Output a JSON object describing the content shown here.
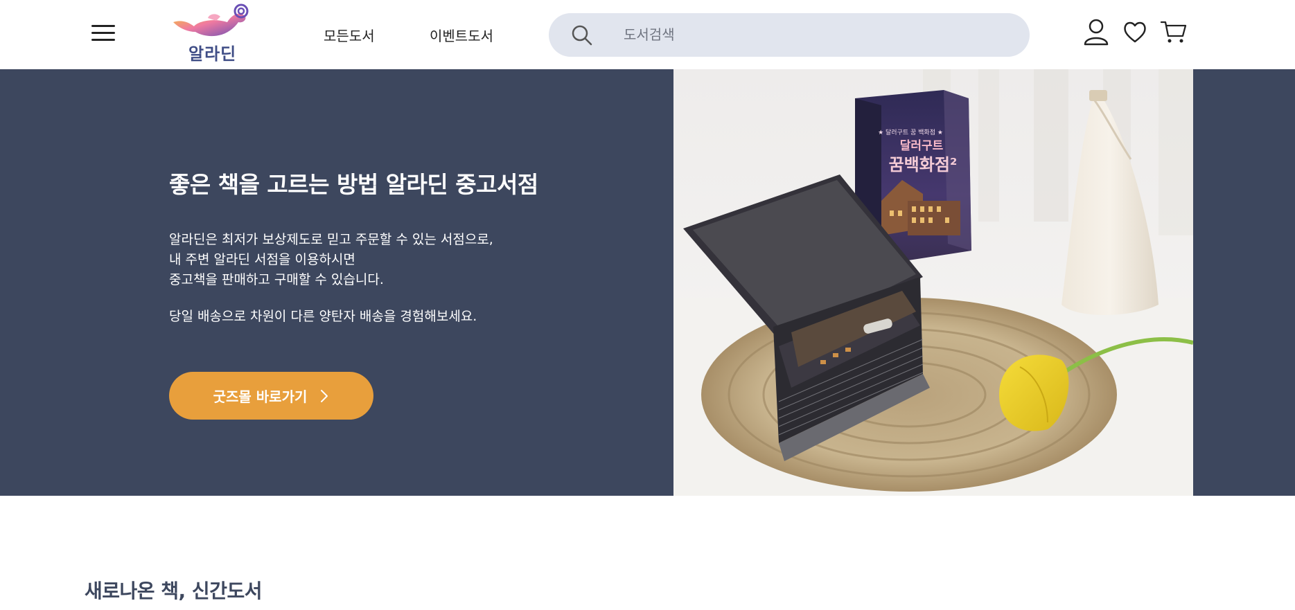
{
  "header": {
    "logo_text": "알라딘",
    "nav": {
      "all_books": "모든도서",
      "event_books": "이벤트도서"
    },
    "search": {
      "placeholder": "도서검색",
      "value": ""
    },
    "icons": [
      "menu-icon",
      "user-icon",
      "heart-icon",
      "cart-icon",
      "search-icon"
    ]
  },
  "hero": {
    "title": "좋은 책을 고르는 방법 알라딘 중고서점",
    "desc_lines": [
      "알라딘은 최저가 보상제도로 믿고 주문할 수 있는 서점으로,",
      "내 주변 알라딘 서점을 이용하시면",
      "중고책을 판매하고 구매할 수 있습니다."
    ],
    "desc2": "당일 배송으로 차원이 다른 양탄자 배송을 경험해보세요.",
    "button_label": "굿즈몰 바로가기",
    "photo": {
      "book_cover_top": "달러구트",
      "book_cover_title": "꿈 백화점 2"
    }
  },
  "section": {
    "new_books_title": "새로나온 책, 신간도서"
  },
  "colors": {
    "hero_bg": "#3d475e",
    "accent": "#e89f3c",
    "search_bg": "#e1e5ee",
    "brand": "#3f4d86"
  }
}
